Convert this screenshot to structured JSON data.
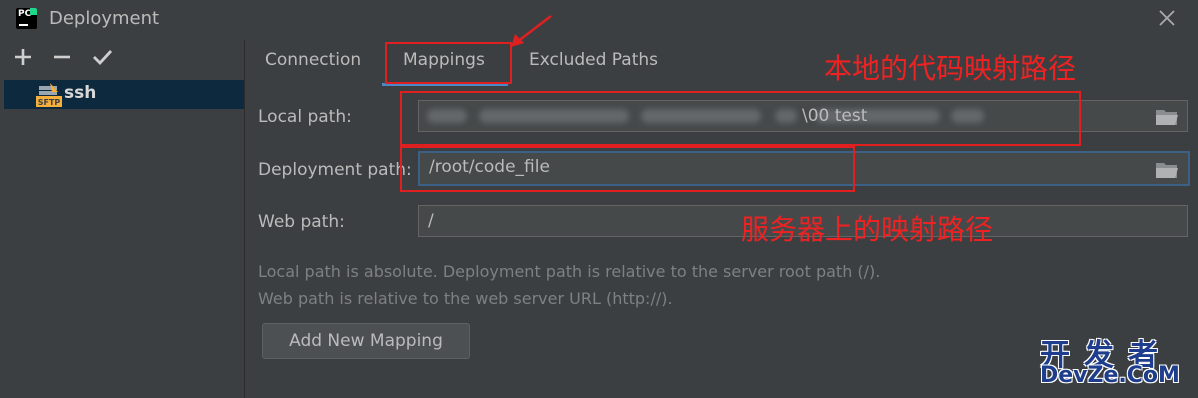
{
  "window": {
    "title": "Deployment"
  },
  "toolbar": {
    "add": "add",
    "remove": "remove",
    "check": "check"
  },
  "servers": [
    {
      "label": "ssh",
      "icon_badge": "SFTP"
    }
  ],
  "tabs": [
    {
      "label": "Connection"
    },
    {
      "label": "Mappings",
      "selected": true
    },
    {
      "label": "Excluded Paths"
    }
  ],
  "mapping": {
    "local_path_label": "Local path:",
    "local_path_value_suffix": "\\00 test",
    "deployment_path_label": "Deployment path:",
    "deployment_path_value": "/root/code_file",
    "web_path_label": "Web path:",
    "web_path_value": "/"
  },
  "hints": {
    "line1": "Local path is absolute. Deployment path is relative to the server root path (/).",
    "line2": "Web path is relative to the web server URL (http://)."
  },
  "buttons": {
    "add_mapping": "Add New Mapping"
  },
  "annotations": {
    "local": "本地的代码映射路径",
    "remote": "服务器上的映射路径"
  },
  "watermark": {
    "cn": "开发者",
    "en": "DevZe.CoM"
  },
  "colors": {
    "accent": "#4a88c7",
    "annotation": "#e02020",
    "selection": "#0d293e"
  }
}
